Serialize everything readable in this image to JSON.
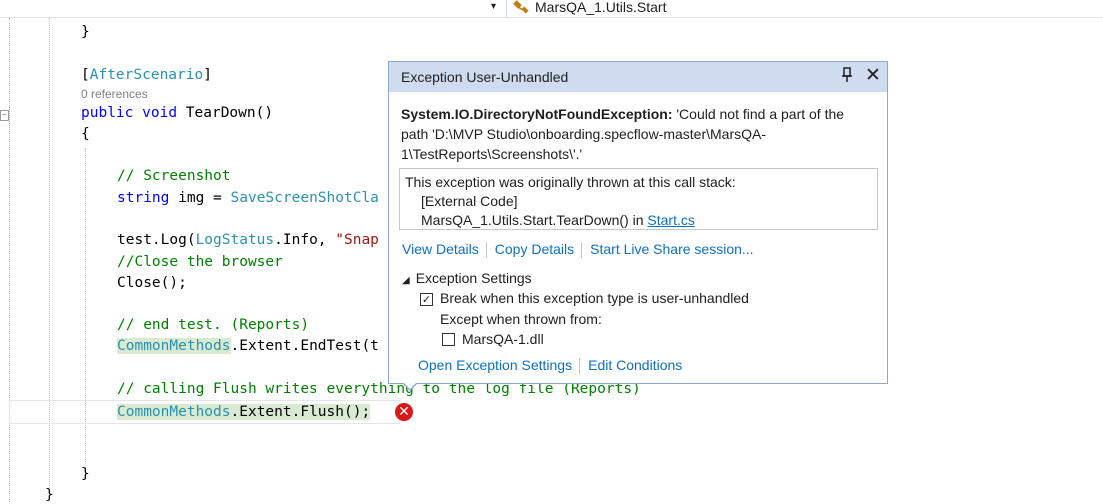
{
  "nav": {
    "dropdown_arrow": "▾",
    "class_icon": "class-icon",
    "class_label": "MarsQA_1.Utils.Start"
  },
  "code": {
    "line1": "}",
    "attr_open": "[",
    "attr_name": "AfterScenario",
    "attr_close": "]",
    "refs": "0 references",
    "sig_public": "public",
    "sig_void": "void",
    "sig_name": " TearDown()",
    "brace_open": "{",
    "comment_screenshot": "// Screenshot",
    "img_type": "string",
    "img_rest": " img = ",
    "img_class": "SaveScreenShotCla",
    "log_prefix": "test.Log(",
    "log_type": "LogStatus",
    "log_mid": ".Info, ",
    "log_str": "\"Snap",
    "comment_close": "//Close the browser",
    "close_call": "Close();",
    "comment_end": "// end test. (Reports)",
    "cm1_type": "CommonMethods",
    "cm1_rest": ".Extent.EndTest(t",
    "comment_flush": "// calling Flush writes everything to the log file (Reports)",
    "cm2_type": "CommonMethods",
    "cm2_rest": ".Extent.Flush();",
    "brace_close_inner": "}",
    "brace_close_outer": "}"
  },
  "error_icon": "✕",
  "popup": {
    "title": "Exception User-Unhandled",
    "pin_glyph": "⊥",
    "close_glyph": "✕",
    "exception_type": "System.IO.DirectoryNotFoundException:",
    "exception_message": " 'Could not find a part of the path 'D:\\MVP Studio\\onboarding.specflow-master\\MarsQA-1\\TestReports\\Screenshots\\'.'",
    "stack_title": "This exception was originally thrown at this call stack:",
    "stack_external": "[External Code]",
    "stack_frame": "MarsQA_1.Utils.Start.TearDown() in ",
    "stack_file": "Start.cs",
    "actions": {
      "view_details": "View Details",
      "copy_details": "Copy Details",
      "live_share": "Start Live Share session..."
    },
    "settings_label": "Exception Settings",
    "break_label": "Break when this exception type is user-unhandled",
    "break_checked": "✓",
    "except_label": "Except when thrown from:",
    "dll_label": "MarsQA-1.dll",
    "open_settings": "Open Exception Settings",
    "edit_conditions": "Edit Conditions"
  }
}
